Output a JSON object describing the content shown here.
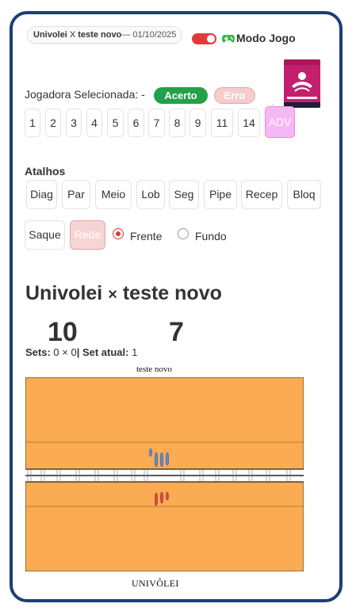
{
  "header": {
    "team_a": "Univolei",
    "separator": "X",
    "team_b": "teste novo",
    "date": "— 01/10/2025",
    "mode_label": "Modo Jogo",
    "mode_on": true
  },
  "player": {
    "label": "Jogadora Selecionada: -",
    "hit_label": "Acerto",
    "error_label": "Erro"
  },
  "numbers": [
    "1",
    "2",
    "3",
    "4",
    "5",
    "6",
    "7",
    "8",
    "9",
    "11",
    "14",
    "ADV"
  ],
  "shortcuts": {
    "title": "Atalhos",
    "items": [
      "Diag",
      "Par",
      "Meio",
      "Lob",
      "Seg",
      "Pipe",
      "Recep",
      "Bloq",
      "Saque",
      "Rede"
    ]
  },
  "position": {
    "front_label": "Frente",
    "back_label": "Fundo",
    "selected": "Frente"
  },
  "scoreboard": {
    "team_a": "Univolei",
    "x": "×",
    "team_b": "teste novo",
    "score_a": "10",
    "score_b": "7",
    "sets_label": "Sets:",
    "sets_value": "0 × 0",
    "current_set_label": "| Set atual:",
    "current_set_value": "1"
  },
  "court": {
    "top_label": "teste novo",
    "bottom_label": "UNIVÔLEI",
    "floor_color": "#fbab52",
    "team_blue_color": "#5b8fd6",
    "team_red_color": "#e04a4a"
  },
  "colors": {
    "frame": "#1c3f75",
    "accent_red": "#e53939",
    "hit_green": "#23a04a",
    "error_pink": "#f6cccc",
    "adv_pink": "#f5b8f4"
  }
}
